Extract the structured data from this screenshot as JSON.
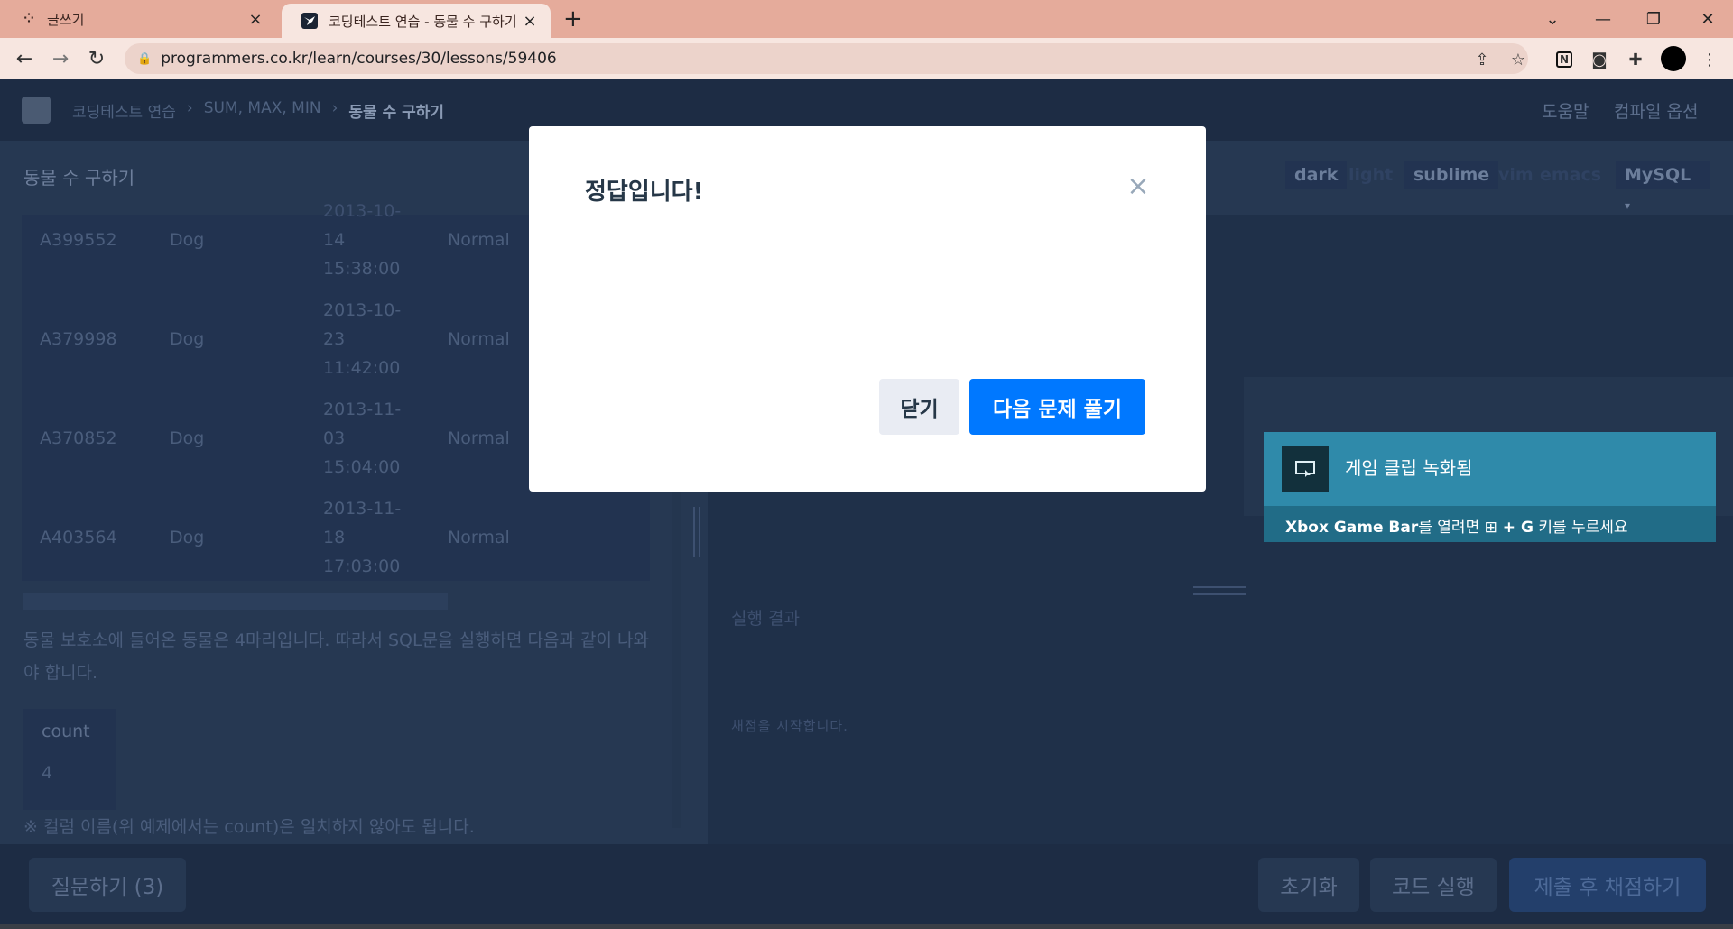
{
  "browser": {
    "tabs": [
      {
        "title": "글쓰기"
      },
      {
        "title": "코딩테스트 연습 - 동물 수 구하기"
      }
    ],
    "url": "programmers.co.kr/learn/courses/30/lessons/59406"
  },
  "header": {
    "breadcrumbs": [
      "코딩테스트 연습",
      "SUM, MAX, MIN",
      "동물 수 구하기"
    ],
    "help": "도움말",
    "compile_options": "컴파일 옵션"
  },
  "subbar": {
    "tab": "동물 수 구하기",
    "themes": [
      "dark",
      "light",
      "sublime",
      "vim",
      "emacs"
    ],
    "language": "MySQL"
  },
  "table": {
    "rows": [
      {
        "id": "A399552",
        "type": "Dog",
        "date": [
          "2013-10-",
          "14",
          "15:38:00"
        ],
        "cond": "Normal"
      },
      {
        "id": "A379998",
        "type": "Dog",
        "date": [
          "2013-10-",
          "23",
          "11:42:00"
        ],
        "cond": "Normal"
      },
      {
        "id": "A370852",
        "type": "Dog",
        "date": [
          "2013-11-",
          "03",
          "15:04:00"
        ],
        "cond": "Normal"
      },
      {
        "id": "A403564",
        "type": "Dog",
        "date": [
          "2013-11-",
          "18",
          "17:03:00"
        ],
        "cond": "Normal"
      }
    ]
  },
  "description": {
    "paragraph": "동물 보호소에 들어온 동물은 4마리입니다. 따라서 SQL문을 실행하면 다음과 같이 나와야 합니다.",
    "result_header": "count",
    "result_value": "4",
    "note": "※ 컬럼 이름(위 예제에서는 count)은 일치하지 않아도 됩니다."
  },
  "result": {
    "title": "실행 결과",
    "message": "채점을 시작합니다."
  },
  "footer": {
    "question": "질문하기 (3)",
    "reset": "초기화",
    "run": "코드 실행",
    "submit": "제출 후 채점하기"
  },
  "modal": {
    "title": "정답입니다!",
    "close_label": "닫기",
    "next_label": "다음 문제 풀기"
  },
  "toast": {
    "title": "게임 클립 녹화됨",
    "msg_bold": "Xbox Game Bar",
    "msg_1": "를 열려면 ",
    "msg_2": " + G",
    "msg_3": " 키를 누르세요"
  }
}
